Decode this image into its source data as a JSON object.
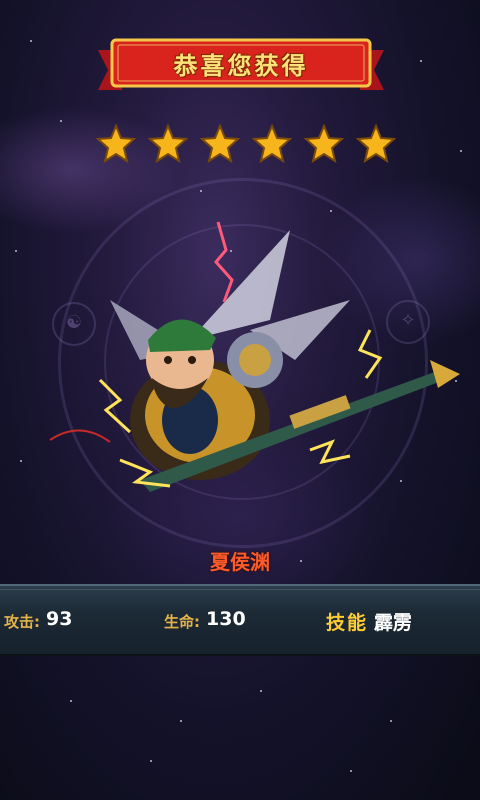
{
  "banner": {
    "title": "恭喜您获得"
  },
  "rating": {
    "stars": 6,
    "max": 6,
    "color": "#f7b51c"
  },
  "hero": {
    "name": "夏侯渊",
    "attack_label": "攻击",
    "attack_value": "93",
    "hp_label": "生命",
    "hp_value": "130",
    "skill_label": "技能",
    "skill_value": "霹雳"
  },
  "icons": [
    "gold-star-icon",
    "hero-character-illustration",
    "lightning-effect"
  ],
  "colors": {
    "name": "#ff5a2a",
    "banner": "#d8241c",
    "accent_gold": "#ffcc33"
  }
}
